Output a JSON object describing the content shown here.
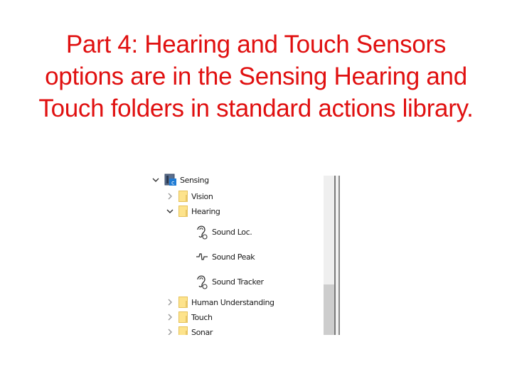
{
  "slide": {
    "title_lines": [
      "Part 4: Hearing and Touch Sensors",
      "options are in the Sensing Hearing and",
      "Touch folders in standard actions library."
    ],
    "title_color": "#e01010"
  },
  "tree": {
    "root": {
      "label": "Sensing",
      "expanded": true,
      "icon": "sensing-library-icon"
    },
    "items": [
      {
        "label": "Vision",
        "type": "folder",
        "expanded": false
      },
      {
        "label": "Hearing",
        "type": "folder",
        "expanded": true,
        "children": [
          {
            "label": "Sound Loc.",
            "icon": "ear-icon"
          },
          {
            "label": "Sound Peak",
            "icon": "waveform-icon"
          },
          {
            "label": "Sound Tracker",
            "icon": "ear-icon"
          }
        ]
      },
      {
        "label": "Human Understanding",
        "type": "folder",
        "expanded": false
      },
      {
        "label": "Touch",
        "type": "folder",
        "expanded": false
      },
      {
        "label": "Sonar",
        "type": "folder",
        "expanded": false
      }
    ]
  },
  "scrollbar": {
    "position_fraction": 1.0
  }
}
